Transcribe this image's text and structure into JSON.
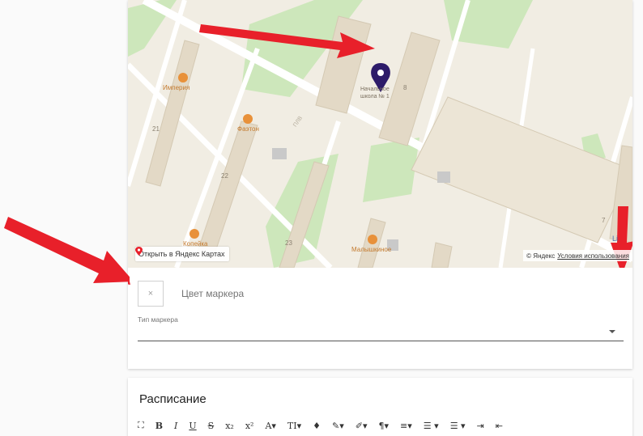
{
  "map": {
    "school_label": "Начальное\nшкола № 1",
    "building_numbers": [
      "21",
      "22",
      "23",
      "8",
      "7"
    ],
    "pois": [
      {
        "name": "Империя"
      },
      {
        "name": "Фаэтон"
      },
      {
        "name": "Копейка"
      },
      {
        "name": "Малышкиное"
      }
    ],
    "street_code": "ПЛВ",
    "open_in_yandex": "Открыть в Яндекс Картах",
    "copyright": "© Яндекс",
    "terms": "Условия использования",
    "corner_badge": "Li",
    "colors": {
      "background": "#f1ede3",
      "building": "#e3d9c6",
      "park": "#cde7bb",
      "road": "#ffffff",
      "marker": "#2d1b69",
      "poi": "#e8913a",
      "arrow": "#e8202a"
    }
  },
  "marker_settings": {
    "color_label": "Цвет маркера",
    "color_clear_icon": "×",
    "type_label": "Тип маркера",
    "type_value": ""
  },
  "schedule": {
    "title": "Расписание",
    "toolbar": [
      {
        "icon": "fullscreen-icon",
        "glyph": "⛶"
      },
      {
        "icon": "bold-icon",
        "glyph": "B"
      },
      {
        "icon": "italic-icon",
        "glyph": "I"
      },
      {
        "icon": "underline-icon",
        "glyph": "U"
      },
      {
        "icon": "strikethrough-icon",
        "glyph": "S"
      },
      {
        "icon": "subscript-icon",
        "glyph": "x₂"
      },
      {
        "icon": "superscript-icon",
        "glyph": "x²"
      },
      {
        "icon": "font-color-icon",
        "glyph": "A▾"
      },
      {
        "icon": "font-size-icon",
        "glyph": "TI▾"
      },
      {
        "icon": "fill-icon",
        "glyph": "♦"
      },
      {
        "icon": "brush-icon",
        "glyph": "✎▾"
      },
      {
        "icon": "marker-icon",
        "glyph": "✐▾"
      },
      {
        "icon": "paragraph-icon",
        "glyph": "¶▾"
      },
      {
        "icon": "align-icon",
        "glyph": "≡▾"
      },
      {
        "icon": "ordered-list-icon",
        "glyph": "☰ ▾"
      },
      {
        "icon": "unordered-list-icon",
        "glyph": "☰ ▾"
      },
      {
        "icon": "indent-icon",
        "glyph": "⇥"
      },
      {
        "icon": "outdent-icon",
        "glyph": "⇤"
      }
    ]
  }
}
